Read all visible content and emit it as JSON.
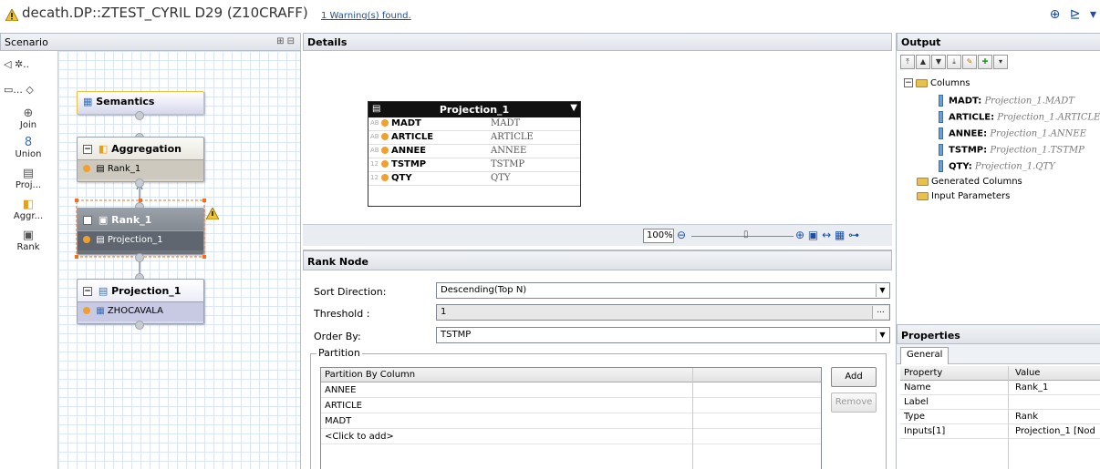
{
  "window": {
    "title": "decath.DP::ZTEST_CYRIL D29 (Z10CRAFF)",
    "warning_link": "1 Warning(s) found."
  },
  "scenario": {
    "header": "Scenario",
    "palette_row1": "◁ ✲..",
    "palette_row2": "▭... ◇",
    "tools": [
      {
        "label": "Join",
        "icon": "join-icon"
      },
      {
        "label": "Union",
        "icon": "union-icon"
      },
      {
        "label": "Proj...",
        "icon": "projection-icon"
      },
      {
        "label": "Aggr...",
        "icon": "aggregation-icon"
      },
      {
        "label": "Rank",
        "icon": "rank-icon"
      }
    ],
    "nodes": {
      "semantics": "Semantics",
      "aggregation": "Aggregation",
      "aggregation_input": "Rank_1",
      "rank": "Rank_1",
      "rank_input": "Projection_1",
      "projection": "Projection_1",
      "projection_input": "ZHOCAVALA"
    }
  },
  "details": {
    "header": "Details",
    "table": {
      "title": "Projection_1",
      "rows": [
        {
          "type": "AB",
          "name": "MADT",
          "value": "MADT"
        },
        {
          "type": "AB",
          "name": "ARTICLE",
          "value": "ARTICLE"
        },
        {
          "type": "AB",
          "name": "ANNEE",
          "value": "ANNEE"
        },
        {
          "type": "12",
          "name": "TSTMP",
          "value": "TSTMP"
        },
        {
          "type": "12",
          "name": "QTY",
          "value": "QTY"
        }
      ]
    },
    "zoom": "100%"
  },
  "rank_node": {
    "header": "Rank Node",
    "sort_direction_label": "Sort Direction:",
    "sort_direction_value": "Descending(Top N)",
    "threshold_label": "Threshold :",
    "threshold_value": "1",
    "order_by_label": "Order By:",
    "order_by_value": "TSTMP",
    "partition_legend": "Partition",
    "partition_header": "Partition By Column",
    "partition_rows": [
      "ANNEE",
      "ARTICLE",
      "MADT",
      "<Click to add>"
    ],
    "add_label": "Add",
    "remove_label": "Remove"
  },
  "output": {
    "header": "Output",
    "columns_label": "Columns",
    "columns": [
      {
        "name": "MADT:",
        "source": "Projection_1.MADT"
      },
      {
        "name": "ARTICLE:",
        "source": "Projection_1.ARTICLE"
      },
      {
        "name": "ANNEE:",
        "source": "Projection_1.ANNEE"
      },
      {
        "name": "TSTMP:",
        "source": "Projection_1.TSTMP"
      },
      {
        "name": "QTY:",
        "source": "Projection_1.QTY"
      }
    ],
    "generated_columns": "Generated Columns",
    "input_parameters": "Input Parameters"
  },
  "properties": {
    "header": "Properties",
    "tab": "General",
    "col_property": "Property",
    "col_value": "Value",
    "rows": [
      {
        "property": "Name",
        "value": "Rank_1"
      },
      {
        "property": "Label",
        "value": ""
      },
      {
        "property": "Type",
        "value": "Rank"
      },
      {
        "property": "Inputs[1]",
        "value": "Projection_1 [Nod"
      }
    ]
  }
}
